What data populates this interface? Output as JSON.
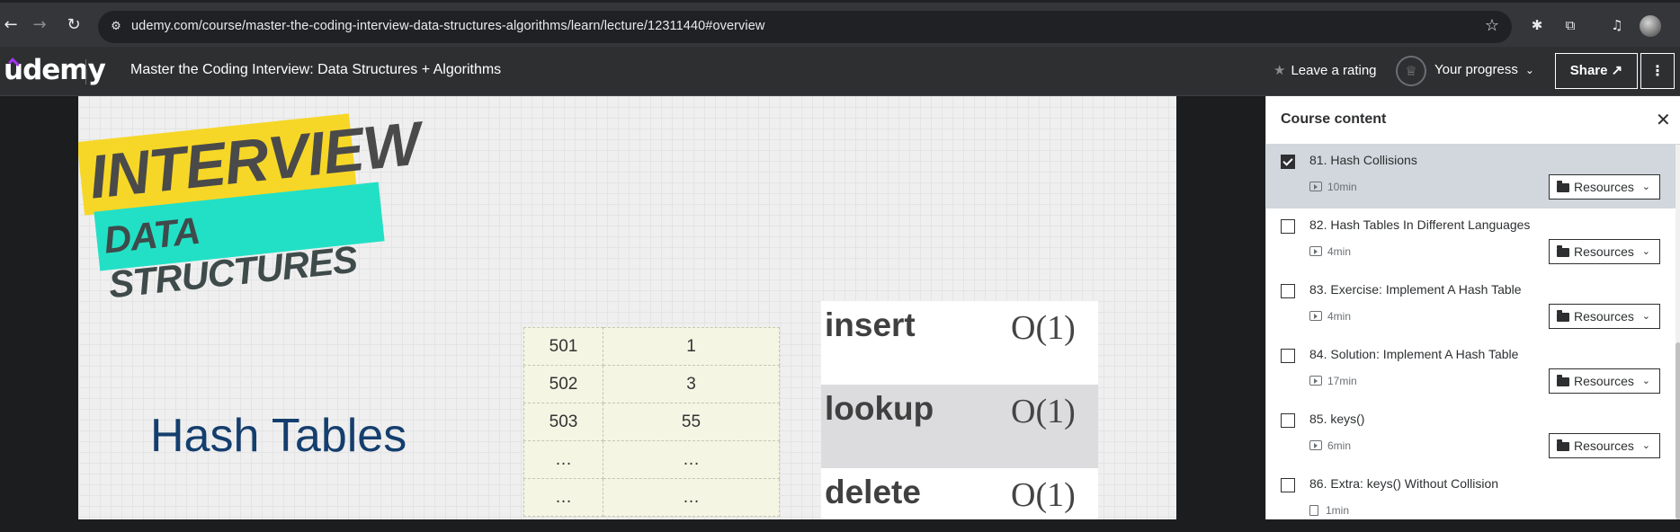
{
  "browser": {
    "url": "udemy.com/course/master-the-coding-interview-data-structures-algorithms/learn/lecture/12311440#overview",
    "back_glyph": "←",
    "forward_glyph": "→",
    "reload_glyph": "↻",
    "site_info_glyph": "⚙",
    "star_glyph": "☆"
  },
  "header": {
    "logo": "udemy",
    "course_title": "Master the Coding Interview: Data Structures + Algorithms",
    "rating_label": "Leave a rating",
    "progress_label": "Your progress",
    "share_label": "Share ↗",
    "more_glyph": "⋮"
  },
  "slide": {
    "badge_top": "INTERVIEW",
    "badge_bottom": "DATA STRUCTURES",
    "title": "Hash Tables",
    "table": [
      {
        "key": "501",
        "value": "1"
      },
      {
        "key": "502",
        "value": "3"
      },
      {
        "key": "503",
        "value": "55"
      },
      {
        "key": "…",
        "value": "…"
      },
      {
        "key": "…",
        "value": "…"
      }
    ],
    "operations": [
      {
        "name": "insert",
        "complexity": "O(1)"
      },
      {
        "name": "lookup",
        "complexity": "O(1)"
      },
      {
        "name": "delete",
        "complexity": "O(1)"
      }
    ]
  },
  "sidebar": {
    "title": "Course content",
    "close_glyph": "✕",
    "resources_label": "Resources",
    "lectures": [
      {
        "title": "81. Hash Collisions",
        "duration": "10min",
        "checked": true,
        "active": true,
        "resources": true,
        "type": "video"
      },
      {
        "title": "82. Hash Tables In Different Languages",
        "duration": "4min",
        "checked": false,
        "active": false,
        "resources": true,
        "type": "video"
      },
      {
        "title": "83. Exercise: Implement A Hash Table",
        "duration": "4min",
        "checked": false,
        "active": false,
        "resources": true,
        "type": "video"
      },
      {
        "title": "84. Solution: Implement A Hash Table",
        "duration": "17min",
        "checked": false,
        "active": false,
        "resources": true,
        "type": "video"
      },
      {
        "title": "85. keys()",
        "duration": "6min",
        "checked": false,
        "active": false,
        "resources": true,
        "type": "video"
      },
      {
        "title": "86. Extra: keys() Without Collision",
        "duration": "1min",
        "checked": false,
        "active": false,
        "resources": false,
        "type": "article"
      }
    ]
  }
}
